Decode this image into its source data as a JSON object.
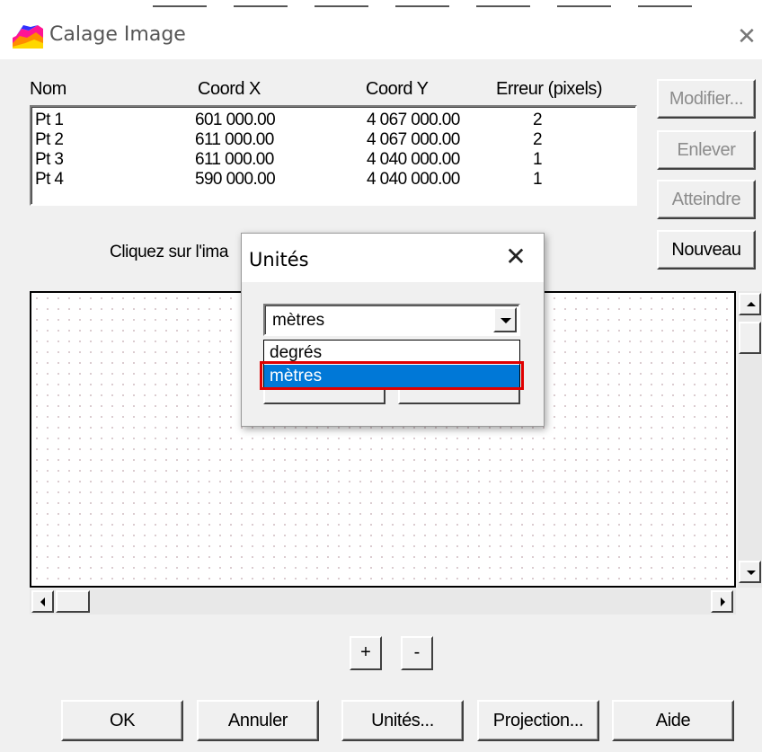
{
  "window": {
    "title": "Calage Image",
    "icon": "calage-app-icon"
  },
  "table": {
    "headers": [
      "Nom",
      "Coord X",
      "Coord Y",
      "Erreur (pixels)"
    ],
    "rows": [
      [
        "Pt 1",
        "601 000.00",
        "4 067 000.00",
        "2"
      ],
      [
        "Pt 2",
        "611 000.00",
        "4 067 000.00",
        "2"
      ],
      [
        "Pt 3",
        "611 000.00",
        "4 040 000.00",
        "1"
      ],
      [
        "Pt 4",
        "590 000.00",
        "4 040 000.00",
        "1"
      ]
    ]
  },
  "side_buttons": {
    "modifier": {
      "label": "Modifier...",
      "enabled": false
    },
    "enlever": {
      "label": "Enlever",
      "enabled": false
    },
    "atteindre": {
      "label": "Atteindre",
      "enabled": false
    },
    "nouveau": {
      "label": "Nouveau",
      "enabled": true
    }
  },
  "instruction": "Cliquez sur l'ima",
  "zoom": {
    "plus": "+",
    "minus": "-"
  },
  "bottom_buttons": {
    "ok": "OK",
    "annuler": "Annuler",
    "unites": "Unités...",
    "projection": "Projection...",
    "aide": "Aide"
  },
  "dialog": {
    "title": "Unités",
    "combo_value": "mètres",
    "options": [
      "degrés",
      "mètres"
    ],
    "selected_option": "mètres",
    "highlight_color": "#e00000",
    "selection_color": "#0078d7"
  }
}
